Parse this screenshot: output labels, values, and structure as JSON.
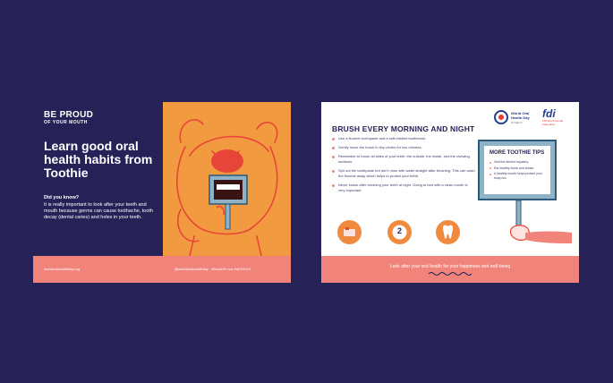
{
  "left_poster": {
    "brand_line1": "BE PROUD",
    "brand_line2": "OF YOUR MOUTH",
    "headline": "Learn good oral health habits from Toothie",
    "did_you_know_label": "Did you know?",
    "did_you_know_text": "It is really important to look after your teeth and mouth because germs can cause toothache, tooth decay (dental caries) and holes in your teeth.",
    "footer_left": "worldoralhealthday.org",
    "footer_right": "@worldoralhealthday · #MouthProud #WOHD21",
    "colors": {
      "navy": "#262257",
      "orange": "#f29a3f",
      "coral": "#f0847a"
    }
  },
  "right_poster": {
    "title": "BRUSH EVERY MORNING AND NIGHT",
    "tips": [
      "Use a fluoride toothpaste and a soft-bristled toothbrush.",
      "Gently move the brush in tiny circles for two minutes.",
      "Remember to brush all sides of your teeth: the outside, the inside, and the chewing surfaces.",
      "Spit out the toothpaste but don't rinse with water straight after brushing. This can wash the fluoride away which helps to protect your teeth.",
      "Never snack after brushing your teeth at night. Going to bed with a clean mouth is very important."
    ],
    "logo_wohd_line1": "World Oral Health Day",
    "logo_wohd_line2": "20 March",
    "logo_fdi": "fdi",
    "logo_fdi_sub": "FDI World Dental Federation",
    "sign_title": "MORE TOOTHIE TIPS",
    "sign_tips": [
      "Visit the dentist regularly.",
      "Eat healthy foods and drinks.",
      "A healthy mouth helps protect your body too."
    ],
    "icon_number": "2",
    "footer": "Look after your oral health for your happiness and well-being"
  }
}
